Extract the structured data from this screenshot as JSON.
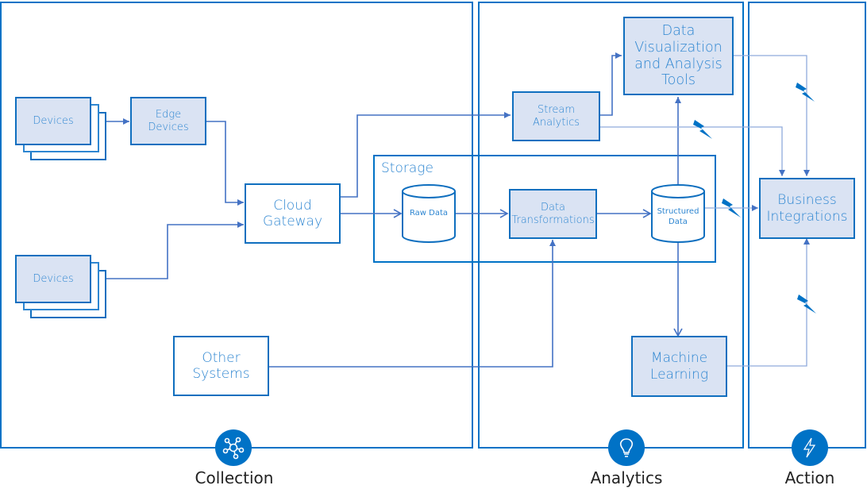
{
  "pillars": [
    {
      "id": "collection",
      "label": "Collection",
      "icon": "network-hub-icon"
    },
    {
      "id": "analytics",
      "label": "Analytics",
      "icon": "lightbulb-icon"
    },
    {
      "id": "action",
      "label": "Action",
      "icon": "lightning-bolt-icon"
    }
  ],
  "nodes": {
    "devices_top": "Devices",
    "edge_devices": "Edge Devices",
    "devices_bottom": "Devices",
    "cloud_gateway": "Cloud Gateway",
    "other_systems": "Other Systems",
    "stream_analytics": "Stream Analytics",
    "data_viz": "Data Visualization and Analysis Tools",
    "storage_group": "Storage",
    "raw_data": "Raw Data",
    "data_transformations": "Data Transformations",
    "structured_data": "Structured Data",
    "machine_learning": "Machine Learning",
    "business_integrations": "Business Integrations"
  },
  "node_lines": {
    "edge_devices": [
      "Edge",
      "Devices"
    ],
    "cloud_gateway": [
      "Cloud",
      "Gateway"
    ],
    "other_systems": [
      "Other",
      "Systems"
    ],
    "stream_analytics": [
      "Stream",
      "Analytics"
    ],
    "data_viz": [
      "Data",
      "Visualization",
      "and Analysis",
      "Tools"
    ],
    "data_transformations": [
      "Data",
      "Transformations"
    ],
    "structured_data": [
      "Structured",
      "Data"
    ],
    "machine_learning": [
      "Machine",
      "Learning"
    ],
    "business_integrations": [
      "Business",
      "Integrations"
    ]
  },
  "edges": [
    {
      "from": "devices_top",
      "to": "edge_devices"
    },
    {
      "from": "edge_devices",
      "to": "cloud_gateway"
    },
    {
      "from": "devices_bottom",
      "to": "cloud_gateway"
    },
    {
      "from": "cloud_gateway",
      "to": "stream_analytics"
    },
    {
      "from": "cloud_gateway",
      "to": "raw_data"
    },
    {
      "from": "raw_data",
      "to": "data_transformations"
    },
    {
      "from": "data_transformations",
      "to": "structured_data"
    },
    {
      "from": "other_systems",
      "to": "data_transformations"
    },
    {
      "from": "stream_analytics",
      "to": "data_viz"
    },
    {
      "from": "structured_data",
      "to": "data_viz",
      "bidirectional": true
    },
    {
      "from": "structured_data",
      "to": "machine_learning"
    },
    {
      "from": "stream_analytics",
      "to": "business_integrations",
      "style": "event"
    },
    {
      "from": "data_viz",
      "to": "business_integrations",
      "style": "event"
    },
    {
      "from": "structured_data",
      "to": "business_integrations",
      "style": "event"
    },
    {
      "from": "machine_learning",
      "to": "business_integrations",
      "style": "event"
    }
  ],
  "colors": {
    "accent": "#0072C6",
    "node_border": "#0F6FBF",
    "node_fill": "#DAE3F3",
    "node_text": "#2E86D1",
    "arrow": "#4472C4",
    "event_line": "#8FAADC"
  }
}
